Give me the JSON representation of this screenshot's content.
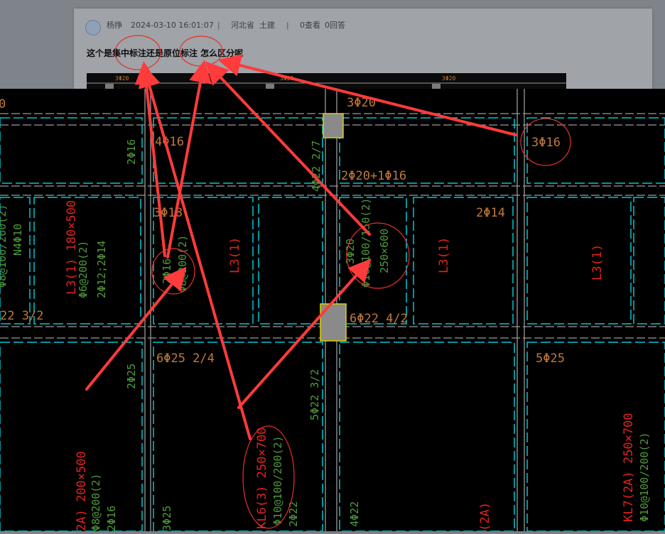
{
  "post": {
    "author": "杨挣",
    "datetime": "2024-03-10 16:01:07",
    "sep": "|",
    "province": "河北省",
    "category": "土建",
    "views": "0查看",
    "answers": "0回答",
    "title": "这个是集中标注还是原位标注 怎么区分呢"
  },
  "drawing": {
    "labels": {
      "top_3phi20": "3Φ20",
      "left_0": "0",
      "phi16_4": "4Φ16",
      "phi16_2": "2Φ16",
      "phi22_217": "4Φ22 2/7",
      "rebar_2phi20_1phi16": "2Φ20+1Φ16",
      "right_3phi16": "3Φ16",
      "r_2phi14": "2Φ14",
      "phi18_3": "3Φ18",
      "l3_1_a": "L3(1)",
      "l3_1_b": "L3(1)",
      "l3_1_c": "L3(1)",
      "l3_180": "L3(1) 180×500",
      "stirrup_6_200": "Φ6@200(2)",
      "rebar_2phi12_2phi14": "2Φ12;2Φ14",
      "left_stirrup_108": "Φ8@100/200(2)",
      "left_n4phi10": "N4Φ10",
      "phi22_32_left": "22 3/2",
      "center_2phi16": "2Φ16",
      "center_stirrup_80": "Φ8@200(2)",
      "mid_3phi20": "3Φ20",
      "mid_stirrup": "Φ10@100/150(2)",
      "mid_250x600": "250×600",
      "phi22_42": "6Φ22 4/2",
      "phi25_24": "6Φ25 2/4",
      "phi25_5": "5Φ25",
      "phi25_2": "2Φ25",
      "phi22_532": "5Φ22 3/2",
      "kl6": "KL6(3) 250×700",
      "kl6_stirrup": "Φ10@100/200(2)",
      "kl6_2phi22": "2Φ22",
      "phi22_4": "4Φ22",
      "kl7": "KL7(2A) 250×700",
      "kl7_stirrup": "Φ10@100/200(2)",
      "left_2a": "2A) 200×500",
      "left_2a_stirrup": "Φ8@200(2)",
      "left_2a_phi16": "2Φ16",
      "left_3phi25": "3Φ25",
      "bottom_2a": "(2A)",
      "thumb_a": "3Φ20",
      "thumb_b": "3Φ20",
      "thumb_c": "3Φ20"
    },
    "colors": {
      "cyan": "#00c8d2",
      "grey": "#9a9a9a",
      "red": "#e0231f",
      "green": "#4f9a3a",
      "orange": "#c07a3a",
      "arrow": "#ff3b3b"
    }
  }
}
